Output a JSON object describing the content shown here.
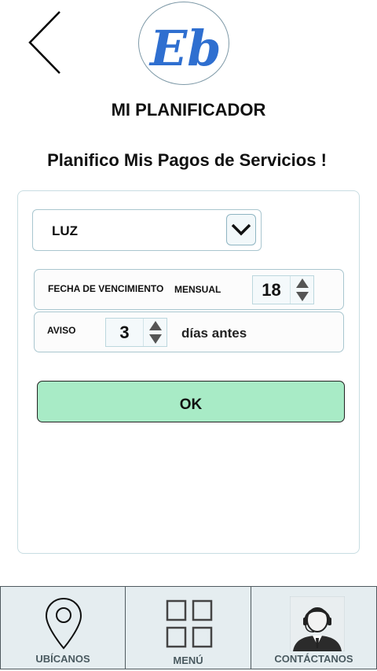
{
  "header": {
    "logo_text": "Eb",
    "title": "MI PLANIFICADOR",
    "subtitle": "Planifico Mis Pagos de Servicios !"
  },
  "form": {
    "service_select": {
      "value": "LUZ"
    },
    "due_date": {
      "label": "FECHA DE VENCIMIENTO",
      "frequency_label": "MENSUAL",
      "day_value": "18"
    },
    "reminder": {
      "label": "AVISO",
      "days_value": "3",
      "suffix": "días antes"
    },
    "submit_label": "OK"
  },
  "bottom_nav": {
    "items": [
      {
        "label": "UBÍCANOS",
        "icon": "map-pin-icon"
      },
      {
        "label": "MENÚ",
        "icon": "grid-icon"
      },
      {
        "label": "CONTÁCTANOS",
        "icon": "support-agent-icon"
      }
    ]
  },
  "colors": {
    "ok_button": "#a8ebc6",
    "logo_blue": "#2f6fd0",
    "nav_background": "#e5edf0"
  }
}
